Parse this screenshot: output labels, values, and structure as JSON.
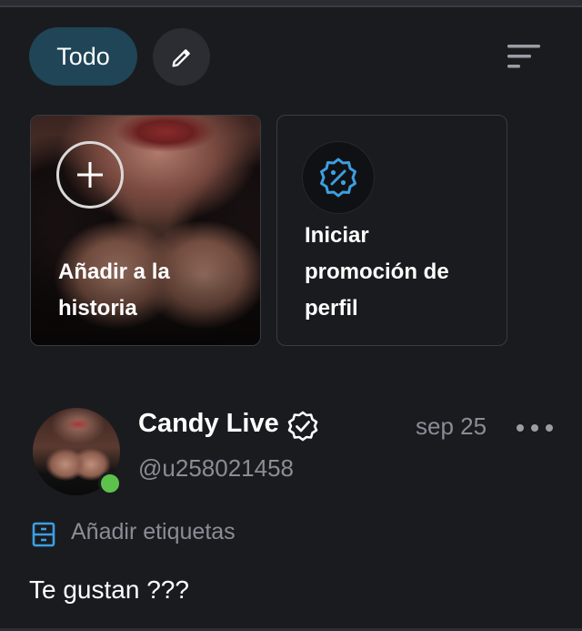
{
  "filters": {
    "active_label": "Todo",
    "edit_icon": "pencil-icon",
    "sort_icon": "sort-lines-icon"
  },
  "cards": {
    "story_label_line1": "Añadir a la",
    "story_label_line2": "historia",
    "story_icon": "plus-icon",
    "promo_label_line1": "Iniciar",
    "promo_label_line2": "promoción de",
    "promo_label_line3": "perfil",
    "promo_icon": "discount-badge-icon"
  },
  "post": {
    "author_name": "Candy Live",
    "author_handle": "@u258021458",
    "verified_icon": "verified-badge-icon",
    "date": "sep 25",
    "tags_label": "Añadir etiquetas",
    "tags_icon": "tag-drawer-icon",
    "text": "Te gustan ???",
    "online_status_color": "#5dc24c"
  },
  "colors": {
    "background": "#1a1b1f",
    "chip_active": "#1f4557",
    "accent_blue": "#3d9fe0",
    "muted_text": "#8a8d95"
  }
}
